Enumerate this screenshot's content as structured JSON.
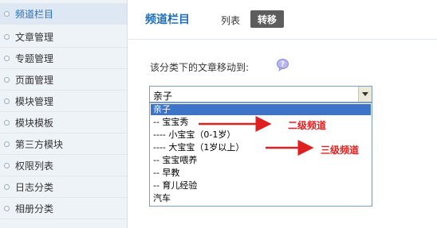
{
  "sidebar": {
    "items": [
      {
        "label": "频道栏目",
        "active": true
      },
      {
        "label": "文章管理"
      },
      {
        "label": "专题管理"
      },
      {
        "label": "页面管理"
      },
      {
        "label": "模块管理"
      },
      {
        "label": "模块模板"
      },
      {
        "label": "第三方模块"
      },
      {
        "label": "权限列表"
      },
      {
        "label": "日志分类"
      },
      {
        "label": "相册分类"
      }
    ]
  },
  "header": {
    "title": "频道栏目",
    "tabs": [
      {
        "label": "列表"
      },
      {
        "label": "转移",
        "active": true
      }
    ]
  },
  "form": {
    "move_label": "该分类下的文章移动到:",
    "help_icon": "help-bubble-icon",
    "select": {
      "value": "亲子",
      "options": [
        {
          "label": "亲子",
          "selected": true
        },
        {
          "label": "-- 宝宝秀"
        },
        {
          "label": "---- 小宝宝（0-1岁）"
        },
        {
          "label": "---- 大宝宝（1岁以上）"
        },
        {
          "label": "-- 宝宝喂养"
        },
        {
          "label": "-- 早教"
        },
        {
          "label": "-- 育儿经验"
        },
        {
          "label": "汽车"
        }
      ]
    }
  },
  "annotations": {
    "level2": "二级频道",
    "level3": "三级频道",
    "color": "#e02020"
  },
  "colors": {
    "accent": "#1f6fb8",
    "selected_option": "#3d73c8",
    "active_tab": "#5d5d5d",
    "sidebar_bg": "#eef3f8"
  }
}
